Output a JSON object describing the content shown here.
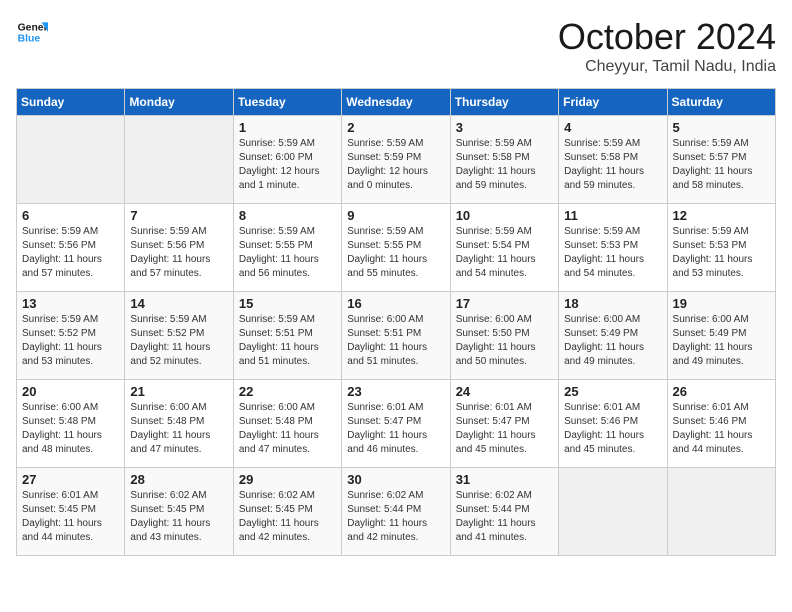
{
  "logo": {
    "line1": "General",
    "line2": "Blue"
  },
  "title": "October 2024",
  "subtitle": "Cheyyur, Tamil Nadu, India",
  "days_of_week": [
    "Sunday",
    "Monday",
    "Tuesday",
    "Wednesday",
    "Thursday",
    "Friday",
    "Saturday"
  ],
  "weeks": [
    [
      {
        "day": "",
        "info": ""
      },
      {
        "day": "",
        "info": ""
      },
      {
        "day": "1",
        "info": "Sunrise: 5:59 AM\nSunset: 6:00 PM\nDaylight: 12 hours\nand 1 minute."
      },
      {
        "day": "2",
        "info": "Sunrise: 5:59 AM\nSunset: 5:59 PM\nDaylight: 12 hours\nand 0 minutes."
      },
      {
        "day": "3",
        "info": "Sunrise: 5:59 AM\nSunset: 5:58 PM\nDaylight: 11 hours\nand 59 minutes."
      },
      {
        "day": "4",
        "info": "Sunrise: 5:59 AM\nSunset: 5:58 PM\nDaylight: 11 hours\nand 59 minutes."
      },
      {
        "day": "5",
        "info": "Sunrise: 5:59 AM\nSunset: 5:57 PM\nDaylight: 11 hours\nand 58 minutes."
      }
    ],
    [
      {
        "day": "6",
        "info": "Sunrise: 5:59 AM\nSunset: 5:56 PM\nDaylight: 11 hours\nand 57 minutes."
      },
      {
        "day": "7",
        "info": "Sunrise: 5:59 AM\nSunset: 5:56 PM\nDaylight: 11 hours\nand 57 minutes."
      },
      {
        "day": "8",
        "info": "Sunrise: 5:59 AM\nSunset: 5:55 PM\nDaylight: 11 hours\nand 56 minutes."
      },
      {
        "day": "9",
        "info": "Sunrise: 5:59 AM\nSunset: 5:55 PM\nDaylight: 11 hours\nand 55 minutes."
      },
      {
        "day": "10",
        "info": "Sunrise: 5:59 AM\nSunset: 5:54 PM\nDaylight: 11 hours\nand 54 minutes."
      },
      {
        "day": "11",
        "info": "Sunrise: 5:59 AM\nSunset: 5:53 PM\nDaylight: 11 hours\nand 54 minutes."
      },
      {
        "day": "12",
        "info": "Sunrise: 5:59 AM\nSunset: 5:53 PM\nDaylight: 11 hours\nand 53 minutes."
      }
    ],
    [
      {
        "day": "13",
        "info": "Sunrise: 5:59 AM\nSunset: 5:52 PM\nDaylight: 11 hours\nand 53 minutes."
      },
      {
        "day": "14",
        "info": "Sunrise: 5:59 AM\nSunset: 5:52 PM\nDaylight: 11 hours\nand 52 minutes."
      },
      {
        "day": "15",
        "info": "Sunrise: 5:59 AM\nSunset: 5:51 PM\nDaylight: 11 hours\nand 51 minutes."
      },
      {
        "day": "16",
        "info": "Sunrise: 6:00 AM\nSunset: 5:51 PM\nDaylight: 11 hours\nand 51 minutes."
      },
      {
        "day": "17",
        "info": "Sunrise: 6:00 AM\nSunset: 5:50 PM\nDaylight: 11 hours\nand 50 minutes."
      },
      {
        "day": "18",
        "info": "Sunrise: 6:00 AM\nSunset: 5:49 PM\nDaylight: 11 hours\nand 49 minutes."
      },
      {
        "day": "19",
        "info": "Sunrise: 6:00 AM\nSunset: 5:49 PM\nDaylight: 11 hours\nand 49 minutes."
      }
    ],
    [
      {
        "day": "20",
        "info": "Sunrise: 6:00 AM\nSunset: 5:48 PM\nDaylight: 11 hours\nand 48 minutes."
      },
      {
        "day": "21",
        "info": "Sunrise: 6:00 AM\nSunset: 5:48 PM\nDaylight: 11 hours\nand 47 minutes."
      },
      {
        "day": "22",
        "info": "Sunrise: 6:00 AM\nSunset: 5:48 PM\nDaylight: 11 hours\nand 47 minutes."
      },
      {
        "day": "23",
        "info": "Sunrise: 6:01 AM\nSunset: 5:47 PM\nDaylight: 11 hours\nand 46 minutes."
      },
      {
        "day": "24",
        "info": "Sunrise: 6:01 AM\nSunset: 5:47 PM\nDaylight: 11 hours\nand 45 minutes."
      },
      {
        "day": "25",
        "info": "Sunrise: 6:01 AM\nSunset: 5:46 PM\nDaylight: 11 hours\nand 45 minutes."
      },
      {
        "day": "26",
        "info": "Sunrise: 6:01 AM\nSunset: 5:46 PM\nDaylight: 11 hours\nand 44 minutes."
      }
    ],
    [
      {
        "day": "27",
        "info": "Sunrise: 6:01 AM\nSunset: 5:45 PM\nDaylight: 11 hours\nand 44 minutes."
      },
      {
        "day": "28",
        "info": "Sunrise: 6:02 AM\nSunset: 5:45 PM\nDaylight: 11 hours\nand 43 minutes."
      },
      {
        "day": "29",
        "info": "Sunrise: 6:02 AM\nSunset: 5:45 PM\nDaylight: 11 hours\nand 42 minutes."
      },
      {
        "day": "30",
        "info": "Sunrise: 6:02 AM\nSunset: 5:44 PM\nDaylight: 11 hours\nand 42 minutes."
      },
      {
        "day": "31",
        "info": "Sunrise: 6:02 AM\nSunset: 5:44 PM\nDaylight: 11 hours\nand 41 minutes."
      },
      {
        "day": "",
        "info": ""
      },
      {
        "day": "",
        "info": ""
      }
    ]
  ]
}
